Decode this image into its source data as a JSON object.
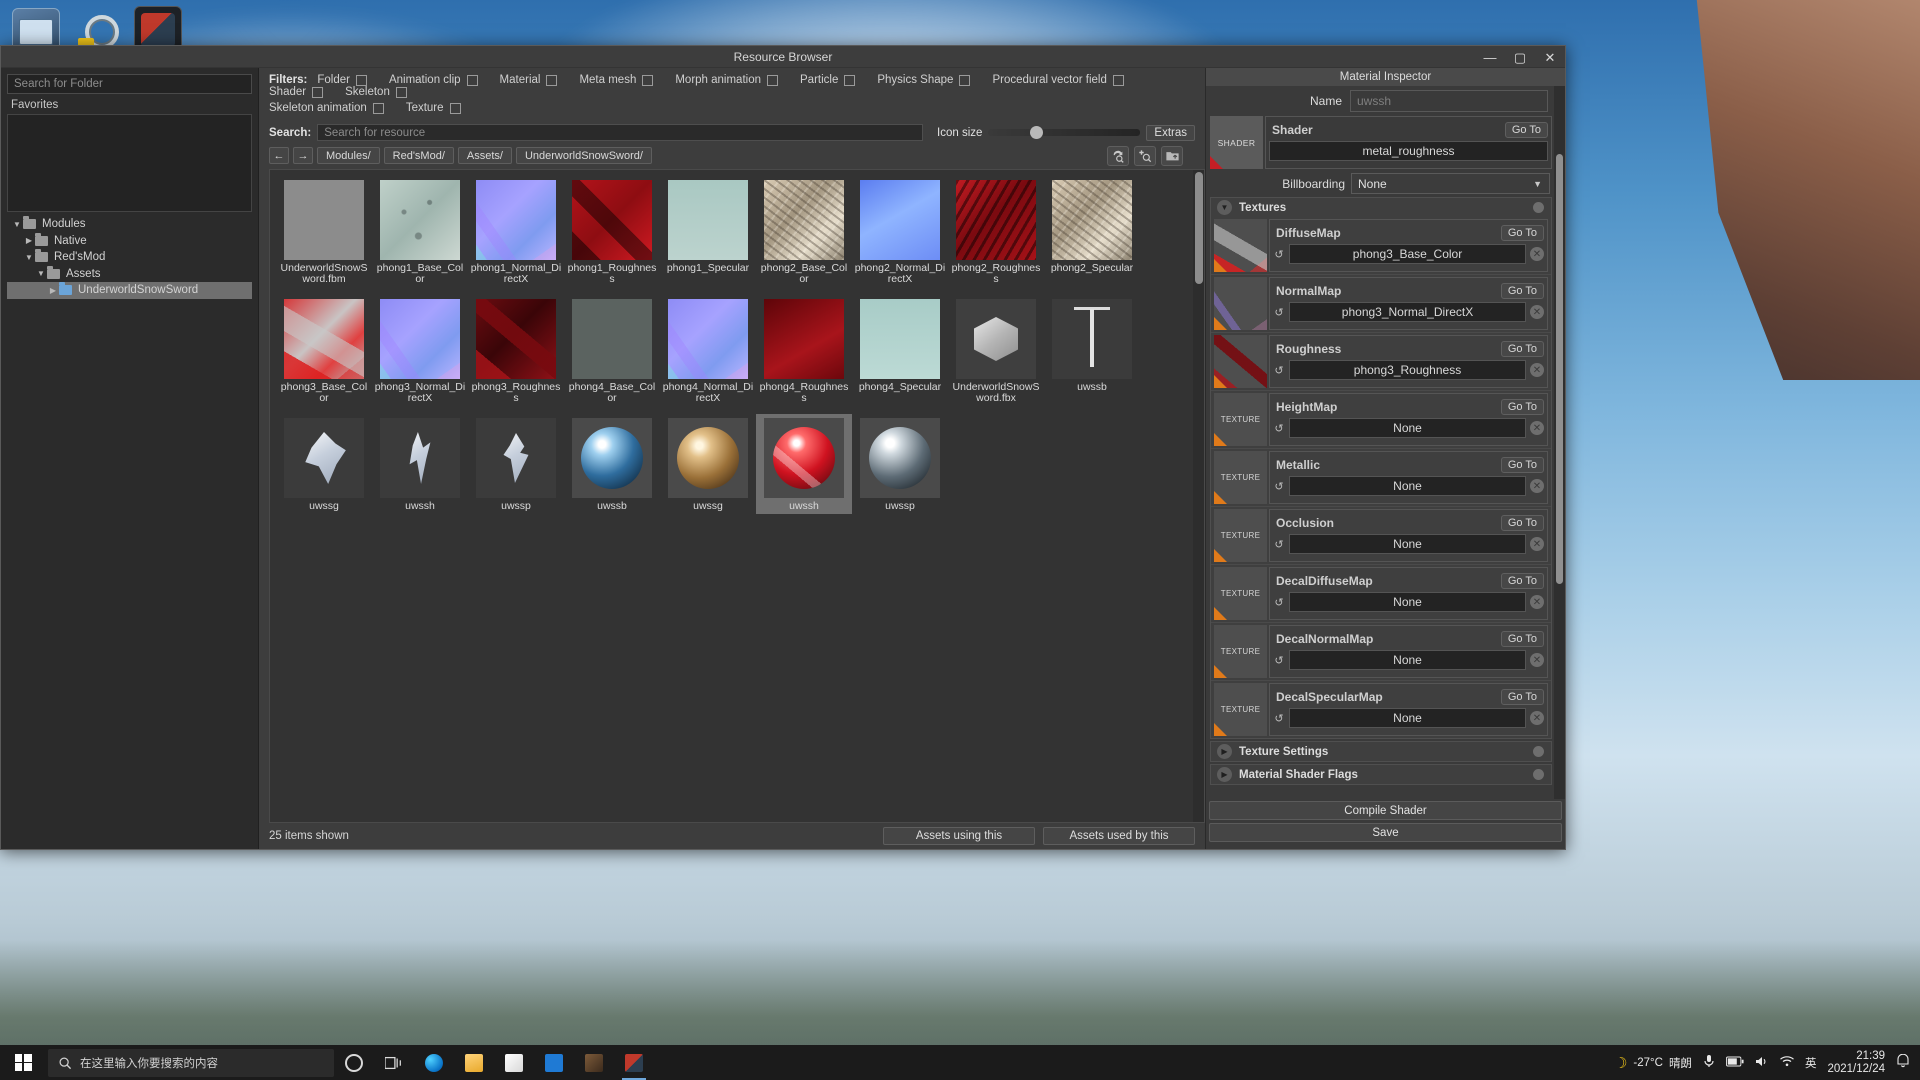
{
  "window": {
    "title": "Resource Browser",
    "minimize": "—",
    "maximize": "▢",
    "close": "✕"
  },
  "left_panel": {
    "search_placeholder": "Search for Folder",
    "favorites_label": "Favorites",
    "tree": [
      {
        "label": "Modules",
        "depth": 0,
        "arrow": "▼",
        "color": "grey",
        "selected": false
      },
      {
        "label": "Native",
        "depth": 1,
        "arrow": "▶",
        "color": "grey",
        "selected": false
      },
      {
        "label": "Red'sMod",
        "depth": 1,
        "arrow": "▼",
        "color": "grey",
        "selected": false
      },
      {
        "label": "Assets",
        "depth": 2,
        "arrow": "▼",
        "color": "grey",
        "selected": false
      },
      {
        "label": "UnderworldSnowSword",
        "depth": 3,
        "arrow": "▶",
        "color": "blue",
        "selected": true
      }
    ]
  },
  "filters": {
    "label": "Filters:",
    "row1": [
      "Folder",
      "Animation clip",
      "Material",
      "Meta mesh",
      "Morph animation",
      "Particle",
      "Physics Shape",
      "Procedural vector field",
      "Shader",
      "Skeleton"
    ],
    "row2": [
      "Skeleton animation",
      "Texture"
    ]
  },
  "search": {
    "label": "Search:",
    "placeholder": "Search for resource",
    "icon_size_label": "Icon size",
    "extras_label": "Extras"
  },
  "nav": {
    "back_icon": "←",
    "forward_icon": "→",
    "breadcrumbs": [
      "Modules/",
      "Red'sMod/",
      "Assets/",
      "UnderworldSnowSword/"
    ],
    "tool_icons": [
      "refresh-search-icon",
      "add-search-icon",
      "folder-upload-icon"
    ]
  },
  "grid": {
    "items": [
      {
        "name": "UnderworldSnowSword.fbm",
        "art": "t-folder",
        "selected": false
      },
      {
        "name": "phong1_Base_Color",
        "art": "t-basecolor1",
        "selected": false
      },
      {
        "name": "phong1_Normal_DirectX",
        "art": "t-normal",
        "selected": false
      },
      {
        "name": "phong1_Roughness",
        "art": "t-rough1",
        "selected": false
      },
      {
        "name": "phong1_Specular",
        "art": "t-spec1",
        "selected": false
      },
      {
        "name": "phong2_Base_Color",
        "art": "t-tan",
        "selected": false
      },
      {
        "name": "phong2_Normal_DirectX",
        "art": "t-normal2",
        "selected": false
      },
      {
        "name": "phong2_Roughness",
        "art": "t-rough2",
        "selected": false
      },
      {
        "name": "phong2_Specular",
        "art": "t-tan",
        "selected": false
      },
      {
        "name": "phong3_Base_Color",
        "art": "t-basecolor3",
        "selected": false
      },
      {
        "name": "phong3_Normal_DirectX",
        "art": "t-normal",
        "selected": false
      },
      {
        "name": "phong3_Roughness",
        "art": "t-darkred",
        "selected": false
      },
      {
        "name": "phong4_Base_Color",
        "art": "t-grey",
        "selected": false
      },
      {
        "name": "phong4_Normal_DirectX",
        "art": "t-normal",
        "selected": false
      },
      {
        "name": "phong4_Roughness",
        "art": "t-grey2",
        "selected": false
      },
      {
        "name": "phong4_Specular",
        "art": "t-teal",
        "selected": false
      },
      {
        "name": "UnderworldSnowSword.fbx",
        "art": "t-fbx",
        "selected": false
      },
      {
        "name": "uwssb",
        "art": "t-blade",
        "selected": false
      },
      {
        "name": "uwssg",
        "art": "t-mesh",
        "selected": false
      },
      {
        "name": "uwssh",
        "art": "t-mesh2",
        "selected": false
      },
      {
        "name": "uwssp",
        "art": "t-mesh3",
        "selected": false
      },
      {
        "name": "uwssb",
        "art": "t-ball sph-b",
        "selected": false
      },
      {
        "name": "uwssg",
        "art": "t-ball sph-g",
        "selected": false
      },
      {
        "name": "uwssh",
        "art": "t-ball sph-r",
        "selected": true
      },
      {
        "name": "uwssp",
        "art": "t-ball sph-s",
        "selected": false
      }
    ]
  },
  "status": {
    "items_shown": "25 items shown",
    "assets_using_this": "Assets using this",
    "assets_used_by_this": "Assets used by this"
  },
  "inspector": {
    "title": "Material Inspector",
    "name_label": "Name",
    "name_value": "uwssh",
    "shader": {
      "icon_label": "SHADER",
      "label": "Shader",
      "goto": "Go To",
      "value": "metal_roughness"
    },
    "billboarding": {
      "label": "Billboarding",
      "value": "None",
      "caret": "▼"
    },
    "textures_section": {
      "label": "Textures",
      "expanded": true,
      "tri": "▼"
    },
    "texture_icon_label": "TEXTURE",
    "goto_label": "Go To",
    "reset_icon": "↺",
    "clear_icon": "✕",
    "textures": [
      {
        "label": "DiffuseMap",
        "value": "phong3_Base_Color",
        "art": "t-basecolor3",
        "has_thumb": true
      },
      {
        "label": "NormalMap",
        "value": "phong3_Normal_DirectX",
        "art": "t-normal",
        "has_thumb": true
      },
      {
        "label": "Roughness",
        "value": "phong3_Roughness",
        "art": "t-darkred",
        "has_thumb": true
      },
      {
        "label": "HeightMap",
        "value": "None",
        "art": "",
        "has_thumb": false
      },
      {
        "label": "Metallic",
        "value": "None",
        "art": "",
        "has_thumb": false
      },
      {
        "label": "Occlusion",
        "value": "None",
        "art": "",
        "has_thumb": false
      },
      {
        "label": "DecalDiffuseMap",
        "value": "None",
        "art": "",
        "has_thumb": false
      },
      {
        "label": "DecalNormalMap",
        "value": "None",
        "art": "",
        "has_thumb": false
      },
      {
        "label": "DecalSpecularMap",
        "value": "None",
        "art": "",
        "has_thumb": false
      }
    ],
    "texture_settings": {
      "label": "Texture Settings",
      "tri": "▶"
    },
    "material_shader_flags": {
      "label": "Material Shader Flags",
      "tri": "▶"
    },
    "compile_shader": "Compile Shader",
    "save": "Save"
  },
  "taskbar": {
    "search_placeholder": "在这里输入你要搜索的内容",
    "temperature": "-27°C",
    "weather_text": "晴朗",
    "lang_ime": "英",
    "time": "21:39",
    "date": "2021/12/24",
    "apps": [
      "cortana-icon",
      "task-view-icon",
      "edge-icon",
      "file-explorer-icon",
      "store-icon",
      "mail-icon",
      "app6-icon",
      "app7-icon"
    ]
  },
  "colors": {
    "accent_blue": "#6fa8dc",
    "selection_grey": "#6f6f6f",
    "panel_bg": "#3d3d3d",
    "shader_red": "#c41f25",
    "texture_orange": "#e07a1a"
  }
}
